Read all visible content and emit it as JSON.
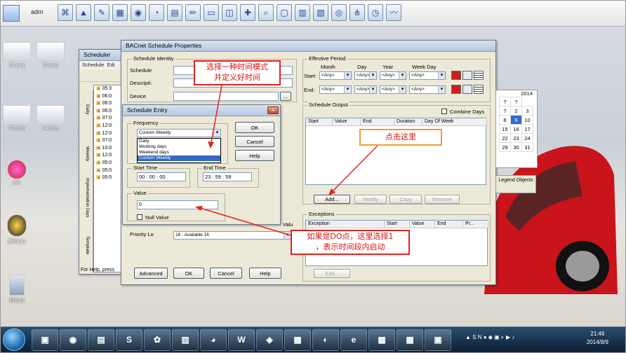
{
  "toolbar": {
    "title": "adm",
    "icons": [
      "network-icon",
      "warning-icon",
      "tools-icon",
      "schedule-icon",
      "globe-icon",
      "gauge-icon",
      "spreadsheet-icon",
      "pen-icon",
      "folder-icon",
      "database-icon",
      "map-icon",
      "search-icon",
      "window-icon",
      "report-icon",
      "image-icon",
      "alarm-icon",
      "tree-icon",
      "clock-icon",
      "trend-icon"
    ]
  },
  "desktop": {
    "icons": [
      {
        "label": "01.png"
      },
      {
        "label": "03.png"
      },
      {
        "label": "02.png"
      },
      {
        "label": "04.png"
      },
      {
        "label": "bat"
      },
      {
        "label": "腾讯QQ"
      },
      {
        "label": "回收站"
      }
    ]
  },
  "scheduler": {
    "title": "Scheduler",
    "menu": [
      "Schedule",
      "Edi"
    ],
    "tabs": [
      "Daily",
      "Weekly",
      "Implementation Days",
      "Template"
    ],
    "times": [
      "05:3",
      "06:0",
      "06:0",
      "06:0",
      "07:0",
      "12:0",
      "12:0",
      "07:0",
      "10:0",
      "12:0",
      "05:0",
      "05:0",
      "05:0"
    ],
    "status": "For Help, press"
  },
  "props": {
    "title": "BACnet Schedule Properties",
    "identity_group": "Schedule Identity",
    "schedule_label": "Schedule",
    "description_label": "Descripti:",
    "device_label": "Device",
    "effective_group": "Effective Period",
    "col_month": "Month",
    "col_day": "Day",
    "col_year": "Year",
    "col_weekday": "Week Day",
    "start_label": "Start:",
    "end_label": "End:",
    "any": "<Any>",
    "output_group": "Schedule Output",
    "combine_days": "Combine Days",
    "output_headers": [
      "Start",
      "Value",
      "End",
      "Duration",
      "Day Of Week"
    ],
    "add": "Add...",
    "modify": "Modify",
    "copy": "Copy",
    "remove": "Remove",
    "legend_objects": "Legend Objects",
    "exceptions_group": "Exceptions",
    "exception_headers": [
      "Exception",
      "Start",
      "Value",
      "End",
      "Pr..."
    ],
    "edit": "Edit...",
    "priority_label": "Priority Lo",
    "priority_value": "16 - Available 16",
    "valu_label": "Valu",
    "advanced": "Advanced",
    "ok": "OK",
    "cancel": "Cancel",
    "help": "Help"
  },
  "calendar": {
    "year": "2014",
    "rows": [
      [
        "?",
        "?"
      ],
      [
        "?",
        "2",
        "3"
      ],
      [
        "8",
        "9",
        "10"
      ],
      [
        "15",
        "16",
        "17"
      ],
      [
        "22",
        "23",
        "24"
      ],
      [
        "29",
        "30",
        "31"
      ]
    ],
    "selected": "9"
  },
  "entry": {
    "title": "Schedule Entry",
    "frequency_group": "Frequency",
    "frequency_value": "Custom Weekly",
    "options": [
      "Daily",
      "Working days",
      "Weekend days",
      "Custom Weekly"
    ],
    "ok": "OK",
    "cancel": "Cancel",
    "help": "Help",
    "start_time_group": "Start Time",
    "end_time_group": "End Time",
    "start": [
      "00",
      "00",
      "00"
    ],
    "end": [
      "23",
      "59",
      "59"
    ],
    "value_group": "Value",
    "value": "0",
    "null_value": "Null Value"
  },
  "annotations": {
    "note1": [
      "选择一种时间模式",
      "并定义好时间"
    ],
    "note2": "点击这里",
    "note3": [
      "如果是DO点，这里选择1",
      "，表示时间段内启动"
    ]
  },
  "taskbar": {
    "apps": [
      "explorer-icon",
      "chrome-icon",
      "folder-icon",
      "sogou-icon",
      "baidu-icon",
      "terminal-icon",
      "hamster-icon",
      "word-icon",
      "wps-icon",
      "chart-icon",
      "qq-icon",
      "ie-icon",
      "building-icon",
      "building2-icon",
      "remote-icon"
    ],
    "time": "21:46",
    "date": "2014/8/9"
  }
}
